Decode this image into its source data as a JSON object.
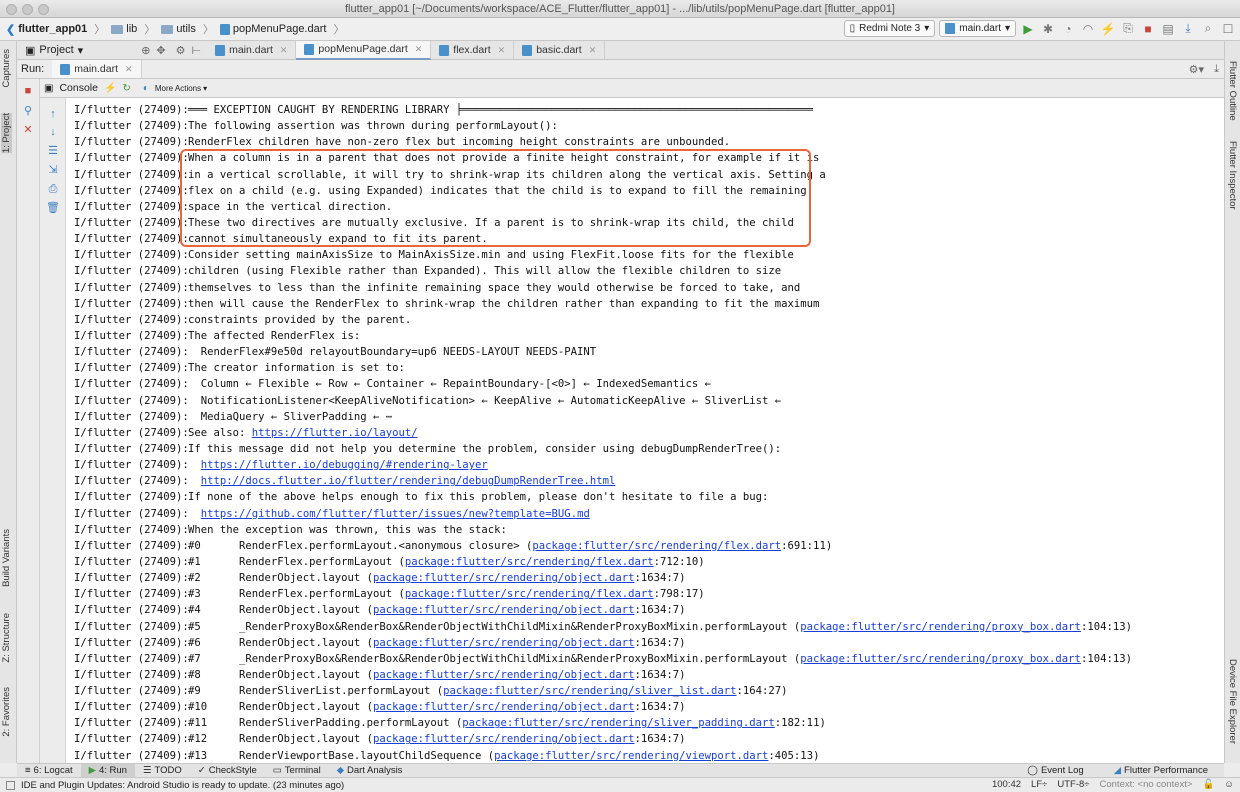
{
  "window": {
    "title": "flutter_app01 [~/Documents/workspace/ACE_Flutter/flutter_app01] - .../lib/utils/popMenuPage.dart [flutter_app01]"
  },
  "navbar": {
    "breadcrumbs": [
      "flutter_app01",
      "lib",
      "utils",
      "popMenuPage.dart"
    ],
    "device": "Redmi Note 3",
    "run_config": "main.dart"
  },
  "tool_windows": {
    "left": [
      "Captures",
      "1: Project",
      "Build Variants",
      "Z: Structure",
      "2: Favorites"
    ],
    "right": [
      "Flutter Outline",
      "Flutter Inspector",
      "Device File Explorer"
    ]
  },
  "project_panel": {
    "label": "Project"
  },
  "editor_tabs": [
    {
      "label": "main.dart",
      "active": false
    },
    {
      "label": "popMenuPage.dart",
      "active": true
    },
    {
      "label": "flex.dart",
      "active": false
    },
    {
      "label": "basic.dart",
      "active": false
    }
  ],
  "run_panel": {
    "label": "Run:",
    "tab": "main.dart",
    "console_tab": "Console",
    "more_actions": "More Actions"
  },
  "console": {
    "prefix": "I/flutter (27409):",
    "lines": [
      [
        {
          "t": "═══ EXCEPTION CAUGHT BY RENDERING LIBRARY ╞═══════════════════════════════════════════════════════"
        }
      ],
      [
        {
          "t": "The following assertion was thrown during performLayout():"
        }
      ],
      [
        {
          "t": "RenderFlex children have non-zero flex but incoming height constraints are unbounded."
        }
      ],
      [
        {
          "t": "When a column is in a parent that does not provide a finite height constraint, for example if it is"
        }
      ],
      [
        {
          "t": "in a vertical scrollable, it will try to shrink-wrap its children along the vertical axis. Setting a"
        }
      ],
      [
        {
          "t": "flex on a child (e.g. using Expanded) indicates that the child is to expand to fill the remaining"
        }
      ],
      [
        {
          "t": "space in the vertical direction."
        }
      ],
      [
        {
          "t": "These two directives are mutually exclusive. If a parent is to shrink-wrap its child, the child"
        }
      ],
      [
        {
          "t": "cannot simultaneously expand to fit its parent."
        }
      ],
      [
        {
          "t": "Consider setting mainAxisSize to MainAxisSize.min and using FlexFit.loose fits for the flexible"
        }
      ],
      [
        {
          "t": "children (using Flexible rather than Expanded). This will allow the flexible children to size"
        }
      ],
      [
        {
          "t": "themselves to less than the infinite remaining space they would otherwise be forced to take, and"
        }
      ],
      [
        {
          "t": "then will cause the RenderFlex to shrink-wrap the children rather than expanding to fit the maximum"
        }
      ],
      [
        {
          "t": "constraints provided by the parent."
        }
      ],
      [
        {
          "t": "The affected RenderFlex is:"
        }
      ],
      [
        {
          "t": "  RenderFlex#9e50d relayoutBoundary=up6 NEEDS-LAYOUT NEEDS-PAINT"
        }
      ],
      [
        {
          "t": "The creator information is set to:"
        }
      ],
      [
        {
          "t": "  Column ← Flexible ← Row ← Container ← RepaintBoundary-[<0>] ← IndexedSemantics ←"
        }
      ],
      [
        {
          "t": "  NotificationListener<KeepAliveNotification> ← KeepAlive ← AutomaticKeepAlive ← SliverList ←"
        }
      ],
      [
        {
          "t": "  MediaQuery ← SliverPadding ← ⋯"
        }
      ],
      [
        {
          "t": "See also: "
        },
        {
          "t": "https://flutter.io/layout/",
          "link": true
        }
      ],
      [
        {
          "t": "If this message did not help you determine the problem, consider using debugDumpRenderTree():"
        }
      ],
      [
        {
          "t": "  "
        },
        {
          "t": "https://flutter.io/debugging/#rendering-layer",
          "link": true
        }
      ],
      [
        {
          "t": "  "
        },
        {
          "t": "http://docs.flutter.io/flutter/rendering/debugDumpRenderTree.html",
          "link": true
        }
      ],
      [
        {
          "t": "If none of the above helps enough to fix this problem, please don't hesitate to file a bug:"
        }
      ],
      [
        {
          "t": "  "
        },
        {
          "t": "https://github.com/flutter/flutter/issues/new?template=BUG.md",
          "link": true
        }
      ],
      [
        {
          "t": "When the exception was thrown, this was the stack:"
        }
      ],
      [
        {
          "t": "#0      RenderFlex.performLayout.<anonymous closure> ("
        },
        {
          "t": "package:flutter/src/rendering/flex.dart",
          "link": true
        },
        {
          "t": ":691:11)"
        }
      ],
      [
        {
          "t": "#1      RenderFlex.performLayout ("
        },
        {
          "t": "package:flutter/src/rendering/flex.dart",
          "link": true
        },
        {
          "t": ":712:10)"
        }
      ],
      [
        {
          "t": "#2      RenderObject.layout ("
        },
        {
          "t": "package:flutter/src/rendering/object.dart",
          "link": true
        },
        {
          "t": ":1634:7)"
        }
      ],
      [
        {
          "t": "#3      RenderFlex.performLayout ("
        },
        {
          "t": "package:flutter/src/rendering/flex.dart",
          "link": true
        },
        {
          "t": ":798:17)"
        }
      ],
      [
        {
          "t": "#4      RenderObject.layout ("
        },
        {
          "t": "package:flutter/src/rendering/object.dart",
          "link": true
        },
        {
          "t": ":1634:7)"
        }
      ],
      [
        {
          "t": "#5      _RenderProxyBox&RenderBox&RenderObjectWithChildMixin&RenderProxyBoxMixin.performLayout ("
        },
        {
          "t": "package:flutter/src/rendering/proxy_box.dart",
          "link": true
        },
        {
          "t": ":104:13)"
        }
      ],
      [
        {
          "t": "#6      RenderObject.layout ("
        },
        {
          "t": "package:flutter/src/rendering/object.dart",
          "link": true
        },
        {
          "t": ":1634:7)"
        }
      ],
      [
        {
          "t": "#7      _RenderProxyBox&RenderBox&RenderObjectWithChildMixin&RenderProxyBoxMixin.performLayout ("
        },
        {
          "t": "package:flutter/src/rendering/proxy_box.dart",
          "link": true
        },
        {
          "t": ":104:13)"
        }
      ],
      [
        {
          "t": "#8      RenderObject.layout ("
        },
        {
          "t": "package:flutter/src/rendering/object.dart",
          "link": true
        },
        {
          "t": ":1634:7)"
        }
      ],
      [
        {
          "t": "#9      RenderSliverList.performLayout ("
        },
        {
          "t": "package:flutter/src/rendering/sliver_list.dart",
          "link": true
        },
        {
          "t": ":164:27)"
        }
      ],
      [
        {
          "t": "#10     RenderObject.layout ("
        },
        {
          "t": "package:flutter/src/rendering/object.dart",
          "link": true
        },
        {
          "t": ":1634:7)"
        }
      ],
      [
        {
          "t": "#11     RenderSliverPadding.performLayout ("
        },
        {
          "t": "package:flutter/src/rendering/sliver_padding.dart",
          "link": true
        },
        {
          "t": ":182:11)"
        }
      ],
      [
        {
          "t": "#12     RenderObject.layout ("
        },
        {
          "t": "package:flutter/src/rendering/object.dart",
          "link": true
        },
        {
          "t": ":1634:7)"
        }
      ],
      [
        {
          "t": "#13     RenderViewportBase.layoutChildSequence ("
        },
        {
          "t": "package:flutter/src/rendering/viewport.dart",
          "link": true
        },
        {
          "t": ":405:13)"
        }
      ]
    ]
  },
  "bottom_tools": [
    {
      "icon": "logcat-icon",
      "label": "6: Logcat",
      "active": false
    },
    {
      "icon": "run-icon",
      "label": "4: Run",
      "active": true
    },
    {
      "icon": "todo-icon",
      "label": "TODO",
      "active": false
    },
    {
      "icon": "checkstyle-icon",
      "label": "CheckStyle",
      "active": false
    },
    {
      "icon": "terminal-icon",
      "label": "Terminal",
      "active": false
    },
    {
      "icon": "dart-analysis-icon",
      "label": "Dart Analysis",
      "active": false
    }
  ],
  "bottom_right": {
    "event_log": "Event Log",
    "flutter_performance": "Flutter Performance"
  },
  "status": {
    "message": "IDE and Plugin Updates: Android Studio is ready to update. (23 minutes ago)",
    "position": "100:42",
    "line_sep": "LF÷",
    "encoding": "UTF-8÷",
    "context": "Context: <no context>"
  },
  "colors": {
    "link": "#1a3fd6",
    "highlight_border": "#e8663a",
    "run_green": "#3d9a3d"
  }
}
